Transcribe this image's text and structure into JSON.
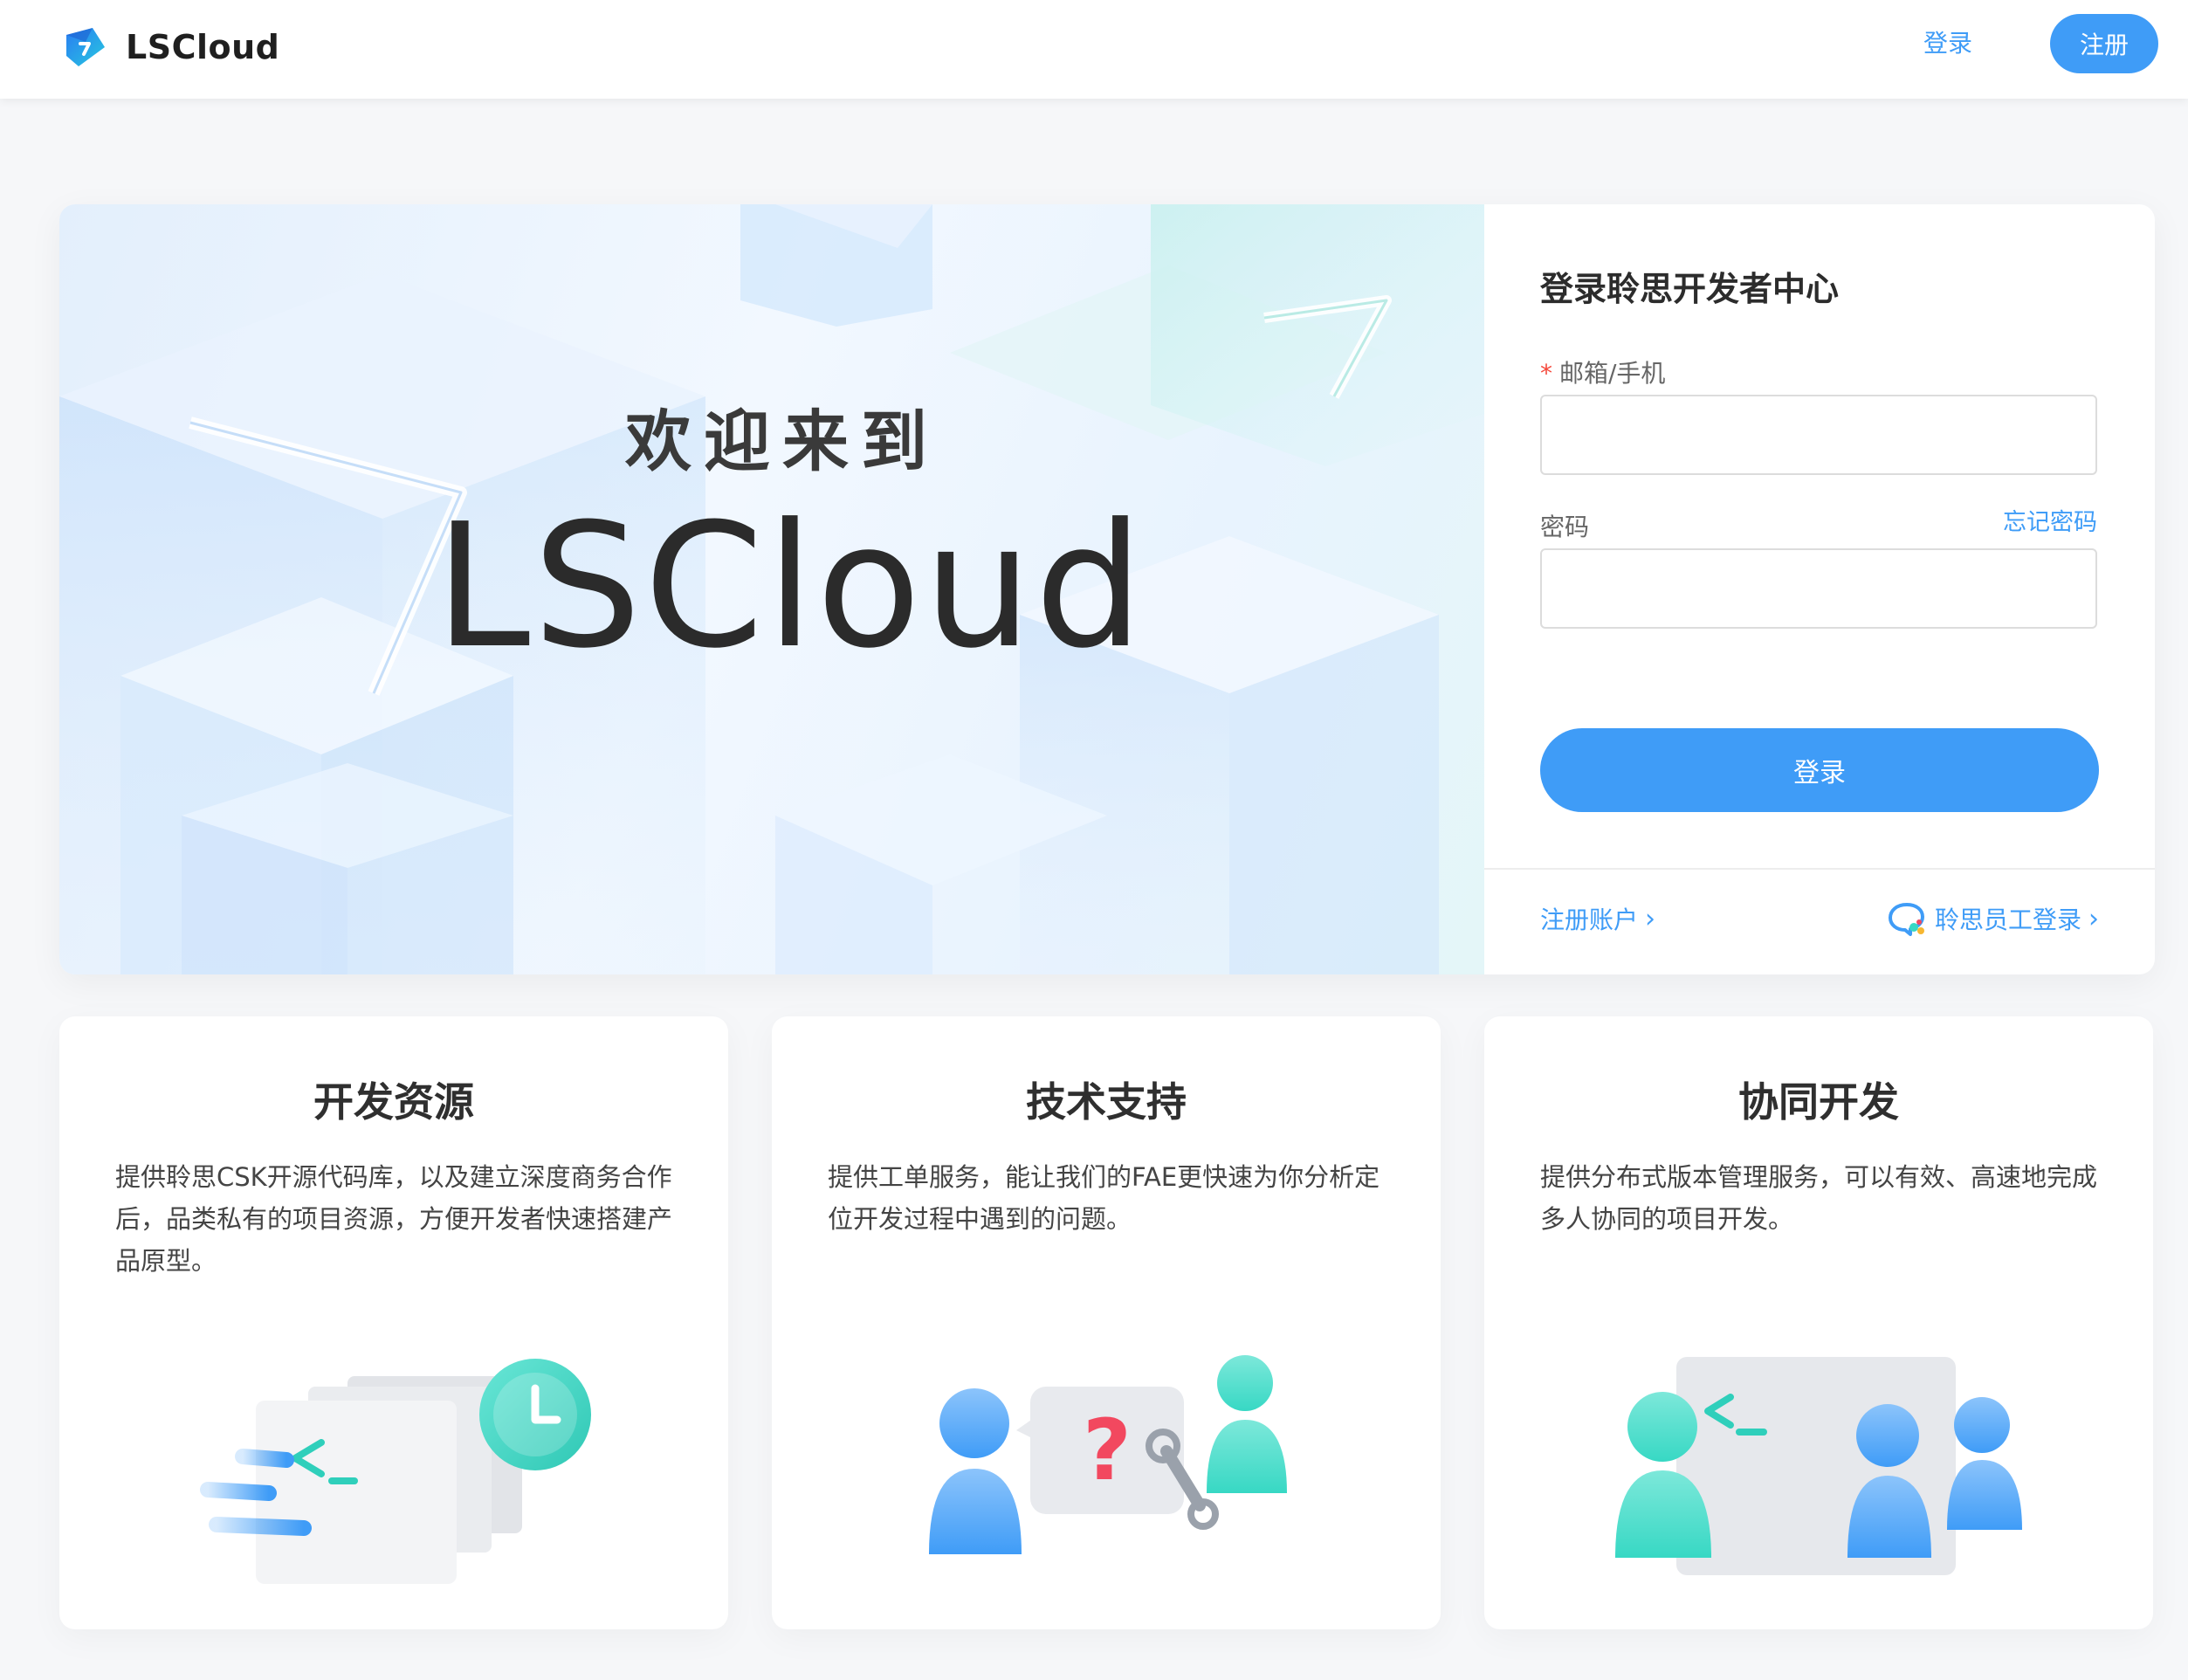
{
  "header": {
    "brand": "LSCloud",
    "login_label": "登录",
    "register_label": "注册"
  },
  "hero": {
    "welcome": "欢迎来到",
    "title": "LSCloud"
  },
  "login": {
    "title": "登录聆思开发者中心",
    "required_mark": "*",
    "account_label": "邮箱/手机",
    "account_value": "",
    "password_label": "密码",
    "password_value": "",
    "forgot_label": "忘记密码",
    "submit_label": "登录",
    "register_link": "注册账户",
    "staff_link": "聆思员工登录",
    "chevron": "›"
  },
  "features": [
    {
      "title": "开发资源",
      "desc": "提供聆思CSK开源代码库，以及建立深度商务合作后，品类私有的项目资源，方便开发者快速搭建产品原型。"
    },
    {
      "title": "技术支持",
      "desc": "提供工单服务，能让我们的FAE更快速为你分析定位开发过程中遇到的问题。"
    },
    {
      "title": "协同开发",
      "desc": "提供分布式版本管理服务，可以有效、高速地完成多人协同的项目开发。"
    }
  ],
  "icons": {
    "brand": "lscloud-logo-icon",
    "question": "question-mark-icon",
    "clock": "clock-icon",
    "terminal": "terminal-prompt-icon",
    "wrench": "wrench-icon",
    "staff": "chat-bubble-icon"
  },
  "colors": {
    "accent": "#3f9cf7",
    "teal": "#37d8c4",
    "required": "#f5483b",
    "question": "#f2485f"
  }
}
